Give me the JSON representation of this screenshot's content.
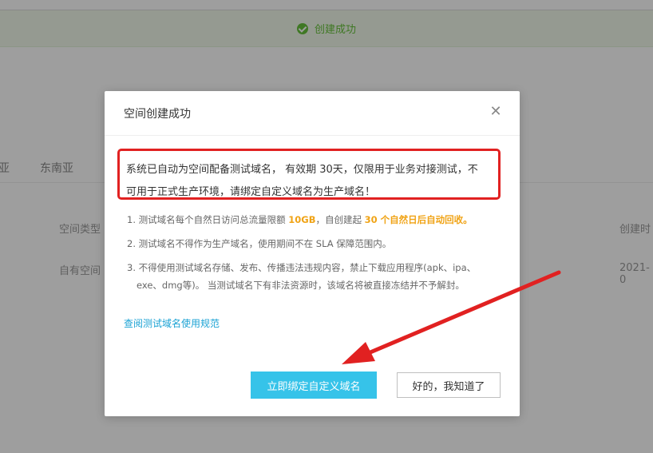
{
  "banner": {
    "success_text": "创建成功",
    "icon": "check-circle-icon",
    "color": "#67c23a"
  },
  "background": {
    "tabs": [
      "亚",
      "东南亚"
    ],
    "table": {
      "col1_header": "空间类型",
      "col1_value": "自有空间",
      "col2_header": "创建时",
      "col2_value": "2021-0"
    }
  },
  "modal": {
    "title": "空间创建成功",
    "close_icon": "close-icon",
    "notice_line1": "系统已自动为空间配备测试域名， 有效期 30天，仅限用于业务对接测试，不",
    "notice_line2": "可用于正式生产环境，请绑定自定义域名为生产域名！",
    "notes": {
      "n1_pre": "1. 测试域名每个自然日访问总流量限额 ",
      "n1_hl1": "10GB",
      "n1_mid": "，自创建起 ",
      "n1_hl2": "30 个自然日后自动回收。",
      "n2": "2. 测试域名不得作为生产域名，使用期间不在 SLA 保障范围内。",
      "n3_line1": "3. 不得使用测试域名存储、发布、传播违法违规内容，禁止下载应用程序(apk、ipa、",
      "n3_line2": "exe、dmg等)。 当测试域名下有非法资源时，该域名将被直接冻结并不予解封。"
    },
    "link": "查阅测试域名使用规范",
    "primary_button": "立即绑定自定义域名",
    "secondary_button": "好的，我知道了"
  },
  "colors": {
    "highlight_border": "#e12121",
    "accent_cyan": "#36c3e9",
    "link": "#1aa2d4",
    "note_highlight": "#f0a315"
  }
}
